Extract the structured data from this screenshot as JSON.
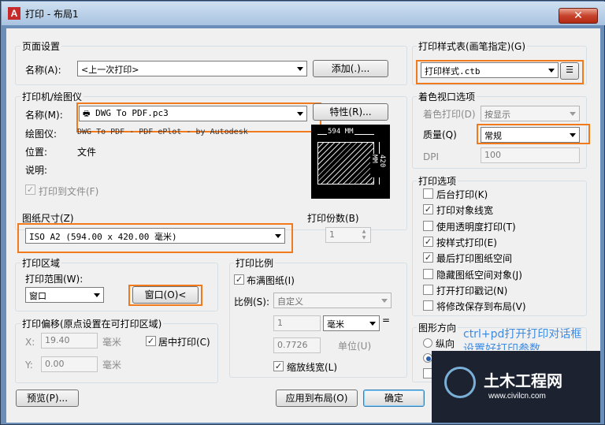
{
  "window": {
    "title": "打印 - 布局1",
    "close_label": "✕",
    "icon_label": "A"
  },
  "page_setup": {
    "group_label": "页面设置",
    "name_label": "名称(A):",
    "name_value": "<上一次打印>",
    "add_button": "添加(.)..."
  },
  "printer": {
    "group_label": "打印机/绘图仪",
    "name_label": "名称(M):",
    "name_value": "DWG To PDF.pc3",
    "properties_button": "特性(R)...",
    "plotter_label": "绘图仪:",
    "plotter_value": "DWG To PDF - PDF ePlot - by Autodesk",
    "location_label": "位置:",
    "location_value": "文件",
    "description_label": "说明:",
    "plot_to_file_label": "打印到文件(F)",
    "plot_to_file_checked": true,
    "paper_width_label": "594 MM",
    "paper_height_label": "420 MM"
  },
  "paper_size": {
    "group_label": "图纸尺寸(Z)",
    "value": "ISO A2 (594.00 x 420.00 毫米)"
  },
  "copies": {
    "label": "打印份数(B)",
    "value": "1"
  },
  "plot_area": {
    "group_label": "打印区域",
    "range_label": "打印范围(W):",
    "range_value": "窗口",
    "window_button": "窗口(O)<"
  },
  "plot_offset": {
    "group_label": "打印偏移(原点设置在可打印区域)",
    "x_label": "X:",
    "x_value": "19.40",
    "x_unit": "毫米",
    "y_label": "Y:",
    "y_value": "0.00",
    "y_unit": "毫米",
    "center_label": "居中打印(C)",
    "center_checked": true
  },
  "plot_scale": {
    "group_label": "打印比例",
    "fit_label": "布满图纸(I)",
    "fit_checked": true,
    "scale_label": "比例(S):",
    "scale_value": "自定义",
    "value1": "1",
    "unit_value": "毫米",
    "equals": "=",
    "value2": "0.7726",
    "unit_label": "单位(U)",
    "lineweights_label": "缩放线宽(L)",
    "lineweights_checked": true
  },
  "style_table": {
    "group_label": "打印样式表(画笔指定)(G)",
    "value": "打印样式.ctb"
  },
  "shaded_viewport": {
    "group_label": "着色视口选项",
    "shade_label": "着色打印(D)",
    "shade_value": "按显示",
    "quality_label": "质量(Q)",
    "quality_value": "常规",
    "dpi_label": "DPI",
    "dpi_value": "100"
  },
  "plot_options": {
    "group_label": "打印选项",
    "items": [
      {
        "label": "后台打印(K)",
        "checked": false
      },
      {
        "label": "打印对象线宽",
        "checked": true
      },
      {
        "label": "使用透明度打印(T)",
        "checked": false
      },
      {
        "label": "按样式打印(E)",
        "checked": true
      },
      {
        "label": "最后打印图纸空间",
        "checked": true
      },
      {
        "label": "隐藏图纸空间对象(J)",
        "checked": false
      },
      {
        "label": "打开打印戳记(N)",
        "checked": false
      },
      {
        "label": "将修改保存到布局(V)",
        "checked": false
      }
    ]
  },
  "orientation": {
    "group_label": "图形方向",
    "portrait_label": "纵向"
  },
  "footer": {
    "preview_button": "预览(P)...",
    "apply_button": "应用到布局(O)",
    "ok_button": "确定"
  },
  "overlay": {
    "caption_line1": "ctrl+pd打开打印对话框",
    "caption_line2": "设置好打印参数",
    "logo_title": "土木工程网",
    "logo_url": "www.civilcn.com",
    "highlight_color": "#f07a1c",
    "caption_color": "#3c8be3"
  }
}
